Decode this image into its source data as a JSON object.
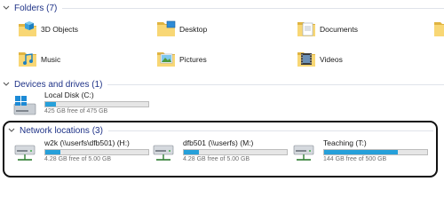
{
  "groups": {
    "folders": {
      "title": "Folders (7)"
    },
    "devices": {
      "title": "Devices and drives (1)"
    },
    "network": {
      "title": "Network locations (3)"
    }
  },
  "folders": [
    {
      "label": "3D Objects",
      "icon": "3d-objects-folder-icon"
    },
    {
      "label": "Desktop",
      "icon": "desktop-folder-icon"
    },
    {
      "label": "Documents",
      "icon": "documents-folder-icon"
    },
    {
      "label": "Music",
      "icon": "music-folder-icon"
    },
    {
      "label": "Pictures",
      "icon": "pictures-folder-icon"
    },
    {
      "label": "Videos",
      "icon": "videos-folder-icon"
    }
  ],
  "drives": [
    {
      "name": "Local Disk (C:)",
      "free": "425 GB free of 475 GB",
      "used_fraction": 0.105,
      "icon": "local-disk-icon"
    }
  ],
  "network_locations": [
    {
      "name": "w2k (\\\\userfs\\dfb501) (H:)",
      "free": "4.28 GB free of 5.00 GB",
      "used_fraction": 0.144,
      "icon": "network-drive-icon"
    },
    {
      "name": "dfb501 (\\\\userfs) (M:)",
      "free": "4.28 GB free of 5.00 GB",
      "used_fraction": 0.144,
      "icon": "network-drive-icon"
    },
    {
      "name": "Teaching (T:)",
      "free": "144 GB free of 500 GB",
      "used_fraction": 0.712,
      "icon": "network-drive-icon"
    }
  ],
  "colors": {
    "group_title": "#1e3287",
    "bar_fill": "#26a0da",
    "folder_yellow": "#f8d775",
    "folder_dark": "#e0b441"
  }
}
